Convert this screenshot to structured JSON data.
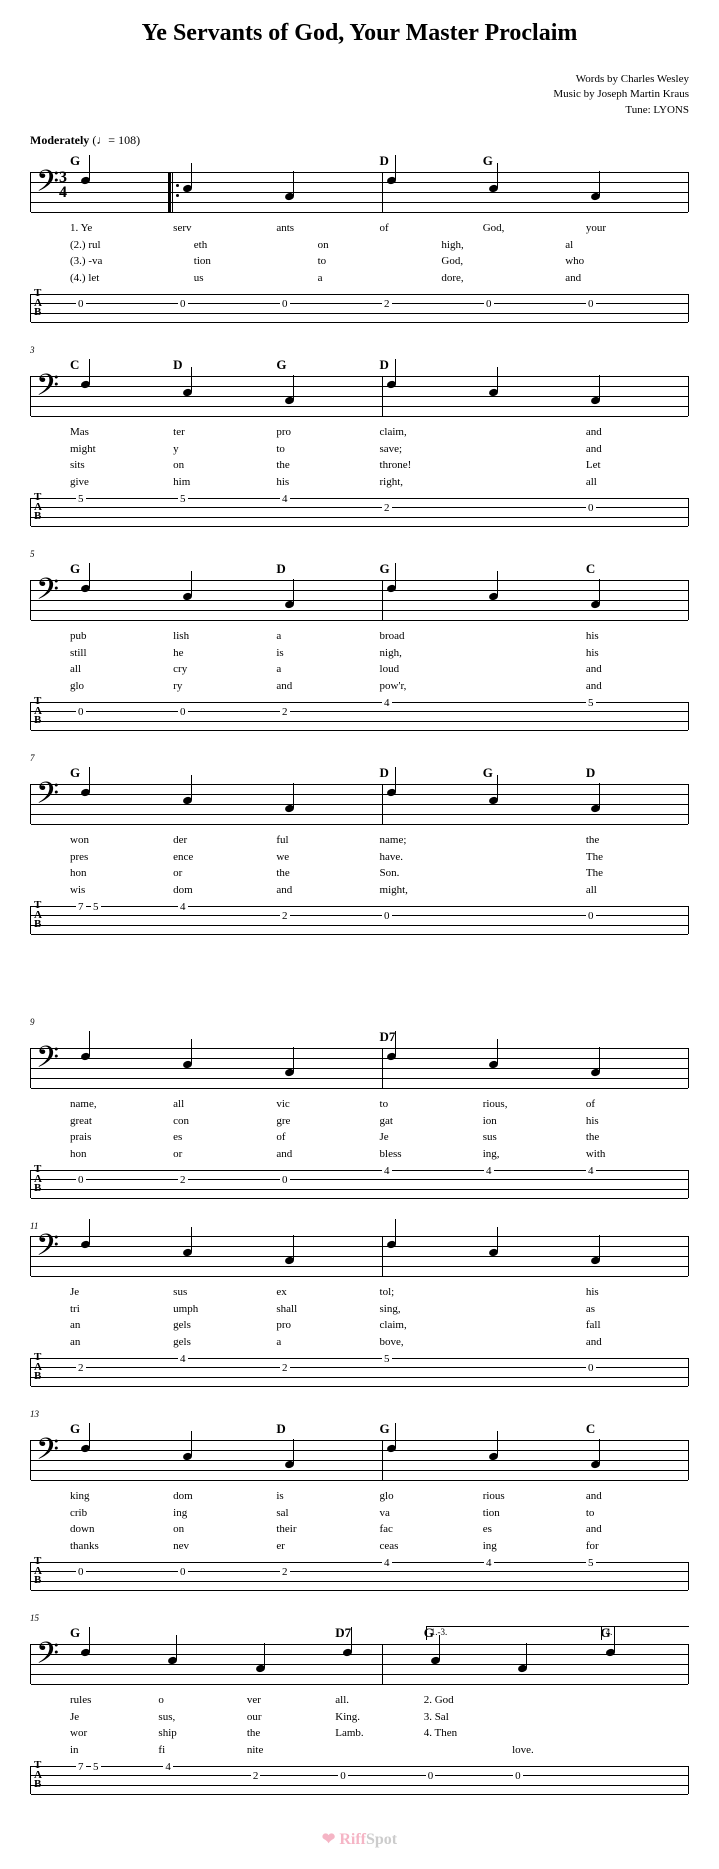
{
  "title": "Ye Servants of God, Your Master Proclaim",
  "credits": {
    "words": "Words by Charles Wesley",
    "music": "Music by Joseph Martin Kraus",
    "tune": "Tune: LYONS"
  },
  "tempo": {
    "label": "Moderately",
    "bpm": "108"
  },
  "timeSignature": {
    "top": "3",
    "bottom": "4"
  },
  "systems": [
    {
      "measureNum": "",
      "showClef": true,
      "showRepeatStart": true,
      "chords": [
        "G",
        "",
        "",
        "D",
        "G",
        ""
      ],
      "lyrics": [
        [
          "1. Ye",
          "serv",
          "ants",
          "of",
          "God,",
          "your"
        ],
        [
          "(2.) rul",
          "eth",
          "on",
          "high,",
          "al"
        ],
        [
          "(3.) -va",
          "tion",
          "to",
          "God,",
          "who"
        ],
        [
          "(4.) let",
          "us",
          "a",
          "dore,",
          "and"
        ]
      ],
      "tab": [
        "0",
        "0",
        "0",
        "2",
        "0",
        "0"
      ]
    },
    {
      "measureNum": "3",
      "showClef": true,
      "chords": [
        "C",
        "D",
        "G",
        "D",
        "",
        ""
      ],
      "lyrics": [
        [
          "Mas",
          "ter",
          "pro",
          "claim,",
          "",
          "and"
        ],
        [
          "might",
          "y",
          "to",
          "save;",
          "",
          "and"
        ],
        [
          "sits",
          "on",
          "the",
          "throne!",
          "",
          "Let"
        ],
        [
          "give",
          "him",
          "his",
          "right,",
          "",
          "all"
        ]
      ],
      "tab": [
        "5",
        "5",
        "4",
        "2",
        "",
        "0"
      ]
    },
    {
      "measureNum": "5",
      "showClef": true,
      "chords": [
        "G",
        "",
        "D",
        "G",
        "",
        "C"
      ],
      "lyrics": [
        [
          "pub",
          "lish",
          "a",
          "broad",
          "",
          "his"
        ],
        [
          "still",
          "he",
          "is",
          "nigh,",
          "",
          "his"
        ],
        [
          "all",
          "cry",
          "a",
          "loud",
          "",
          "and"
        ],
        [
          "glo",
          "ry",
          "and",
          "pow'r,",
          "",
          "and"
        ]
      ],
      "tab": [
        "0",
        "0",
        "2",
        "4",
        "",
        "5"
      ]
    },
    {
      "measureNum": "7",
      "showClef": true,
      "chords": [
        "G",
        "",
        "",
        "D",
        "G",
        "D"
      ],
      "lyrics": [
        [
          "won",
          "der",
          "ful",
          "name;",
          "",
          "the"
        ],
        [
          "pres",
          "ence",
          "we",
          "have.",
          "",
          "The"
        ],
        [
          "hon",
          "or",
          "the",
          "Son.",
          "",
          "The"
        ],
        [
          "wis",
          "dom",
          "and",
          "might,",
          "",
          "all"
        ]
      ],
      "tab": [
        "7 5",
        "4",
        "2",
        "0",
        "",
        "0"
      ]
    },
    {
      "measureNum": "9",
      "pageBreak": true,
      "showClef": true,
      "chords": [
        "",
        "",
        "",
        "D7",
        "",
        ""
      ],
      "lyrics": [
        [
          "name,",
          "all",
          "vic",
          "to",
          "rious,",
          "of"
        ],
        [
          "great",
          "con",
          "gre",
          "gat",
          "ion",
          "his"
        ],
        [
          "prais",
          "es",
          "of",
          "Je",
          "sus",
          "the"
        ],
        [
          "hon",
          "or",
          "and",
          "bless",
          "ing,",
          "with"
        ]
      ],
      "tab": [
        "0",
        "2",
        "0",
        "4",
        "4",
        "4"
      ]
    },
    {
      "measureNum": "11",
      "showClef": true,
      "chords": [
        "",
        "",
        "",
        "",
        "",
        ""
      ],
      "lyrics": [
        [
          "Je",
          "sus",
          "ex",
          "tol;",
          "",
          "his"
        ],
        [
          "tri",
          "umph",
          "shall",
          "sing,",
          "",
          "as"
        ],
        [
          "an",
          "gels",
          "pro",
          "claim,",
          "",
          "fall"
        ],
        [
          "an",
          "gels",
          "a",
          "bove,",
          "",
          "and"
        ]
      ],
      "tab": [
        "2",
        "4",
        "2",
        "5",
        "",
        "0"
      ]
    },
    {
      "measureNum": "13",
      "showClef": true,
      "chords": [
        "G",
        "",
        "D",
        "G",
        "",
        "C"
      ],
      "lyrics": [
        [
          "king",
          "dom",
          "is",
          "glo",
          "rious",
          "and"
        ],
        [
          "crib",
          "ing",
          "sal",
          "va",
          "tion",
          "to"
        ],
        [
          "down",
          "on",
          "their",
          "fac",
          "es",
          "and"
        ],
        [
          "thanks",
          "nev",
          "er",
          "ceas",
          "ing",
          "for"
        ]
      ],
      "tab": [
        "0",
        "0",
        "2",
        "4",
        "4",
        "5"
      ]
    },
    {
      "measureNum": "15",
      "showClef": true,
      "showVoltas": true,
      "volta1": "1.-3.",
      "volta2": "4.",
      "chords": [
        "G",
        "",
        "",
        "D7",
        "G",
        "",
        "G"
      ],
      "lyrics": [
        [
          "rules",
          "o",
          "ver",
          "all.",
          "2. God",
          "",
          ""
        ],
        [
          "Je",
          "sus,",
          "our",
          "King.",
          "3. Sal",
          "",
          ""
        ],
        [
          "wor",
          "ship",
          "the",
          "Lamb.",
          "4. Then",
          "",
          ""
        ],
        [
          "in",
          "fi",
          "nite",
          "",
          "",
          "love.",
          ""
        ]
      ],
      "tab": [
        "7 5",
        "4",
        "2",
        "0",
        "0",
        "0",
        ""
      ]
    }
  ],
  "watermark": {
    "brand1": "Riff",
    "brand2": "Spot"
  }
}
